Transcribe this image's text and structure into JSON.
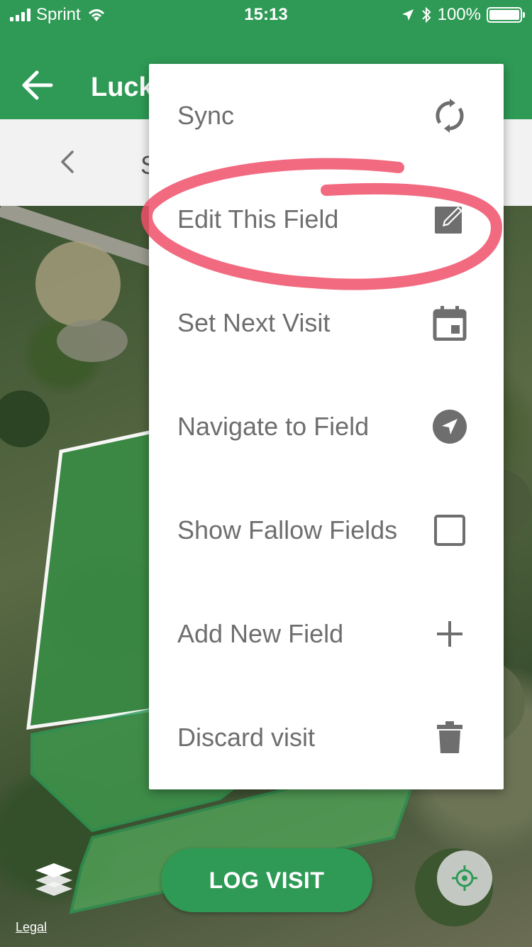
{
  "status_bar": {
    "carrier": "Sprint",
    "time": "15:13",
    "battery": "100%",
    "battery_level": 1.0
  },
  "app_bar": {
    "title": "Luck",
    "back_icon": "arrow-left-icon"
  },
  "sub_bar": {
    "prev_icon": "chevron-left-icon",
    "label": "S"
  },
  "menu": {
    "items": [
      {
        "label": "Sync",
        "icon": "sync-icon"
      },
      {
        "label": "Edit This Field",
        "icon": "edit-icon"
      },
      {
        "label": "Set Next Visit",
        "icon": "calendar-icon"
      },
      {
        "label": "Navigate to Field",
        "icon": "navigate-icon"
      },
      {
        "label": "Show Fallow Fields",
        "icon": "checkbox-icon"
      },
      {
        "label": "Add New Field",
        "icon": "plus-icon"
      },
      {
        "label": "Discard visit",
        "icon": "trash-icon"
      }
    ]
  },
  "map": {
    "legal": "Legal",
    "log_visit": "LOG VISIT",
    "layers_icon": "layers-icon",
    "locate_icon": "crosshair-icon"
  },
  "colors": {
    "primary_green": "#2e9a55",
    "menu_text": "#6e6e6e",
    "annotation_red": "#f0506a"
  }
}
